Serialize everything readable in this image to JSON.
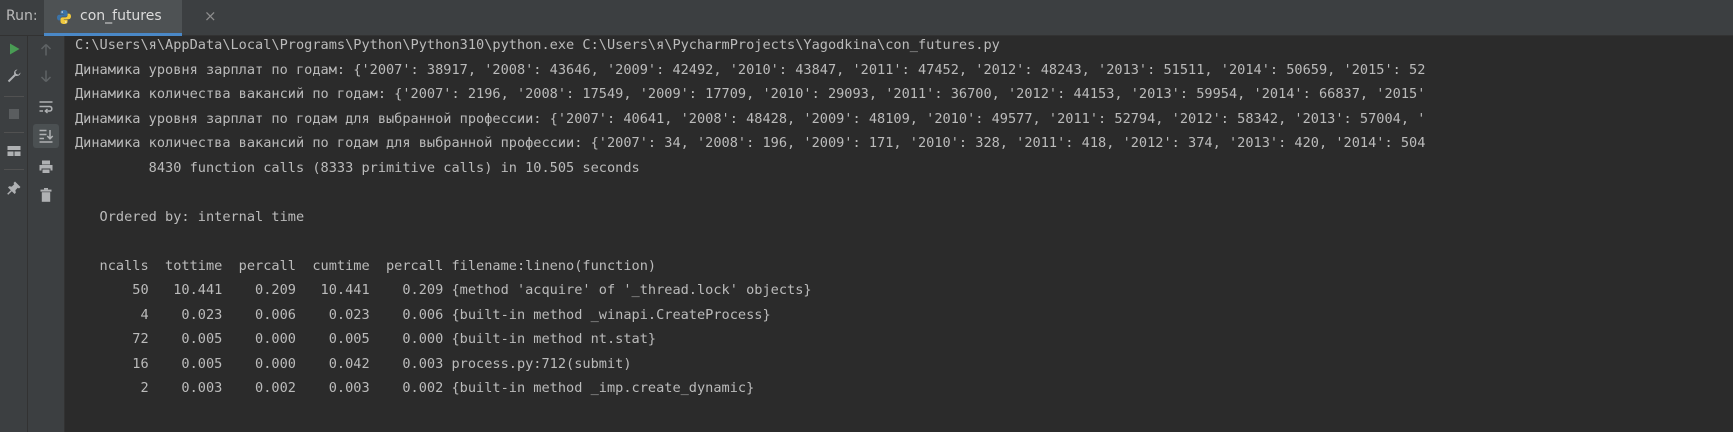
{
  "run_panel": {
    "label": "Run:",
    "tab_label": "con_futures",
    "tab_close": "×"
  },
  "console": {
    "lines": [
      "C:\\Users\\я\\AppData\\Local\\Programs\\Python\\Python310\\python.exe C:\\Users\\я\\PycharmProjects\\Yagodkina\\con_futures.py",
      "Динамика уровня зарплат по годам: {'2007': 38917, '2008': 43646, '2009': 42492, '2010': 43847, '2011': 47452, '2012': 48243, '2013': 51511, '2014': 50659, '2015': 52",
      "Динамика количества вакансий по годам: {'2007': 2196, '2008': 17549, '2009': 17709, '2010': 29093, '2011': 36700, '2012': 44153, '2013': 59954, '2014': 66837, '2015'",
      "Динамика уровня зарплат по годам для выбранной профессии: {'2007': 40641, '2008': 48428, '2009': 48109, '2010': 49577, '2011': 52794, '2012': 58342, '2013': 57004, '",
      "Динамика количества вакансий по годам для выбранной профессии: {'2007': 34, '2008': 196, '2009': 171, '2010': 328, '2011': 418, '2012': 374, '2013': 420, '2014': 504",
      "         8430 function calls (8333 primitive calls) in 10.505 seconds",
      "",
      "   Ordered by: internal time",
      "",
      "   ncalls  tottime  percall  cumtime  percall filename:lineno(function)",
      "       50   10.441    0.209   10.441    0.209 {method 'acquire' of '_thread.lock' objects}",
      "        4    0.023    0.006    0.023    0.006 {built-in method _winapi.CreateProcess}",
      "       72    0.005    0.000    0.005    0.000 {built-in method nt.stat}",
      "       16    0.005    0.000    0.042    0.003 process.py:712(submit)",
      "        2    0.003    0.002    0.003    0.002 {built-in method _imp.create_dynamic}"
    ]
  },
  "colors": {
    "accent": "#4a88c7",
    "run_green": "#499c54",
    "console_bg": "#2b2b2b",
    "panel_bg": "#3c3f41",
    "text": "#bbbbbb"
  },
  "icons": {
    "tab": "python-icon",
    "toolbar1": [
      "run-icon",
      "wrench-icon",
      "stop-icon",
      "layout-icon",
      "pin-icon"
    ],
    "toolbar2": [
      "arrow-up-icon",
      "arrow-down-icon",
      "soft-wrap-icon",
      "scroll-to-end-icon",
      "print-icon",
      "trash-icon"
    ]
  }
}
